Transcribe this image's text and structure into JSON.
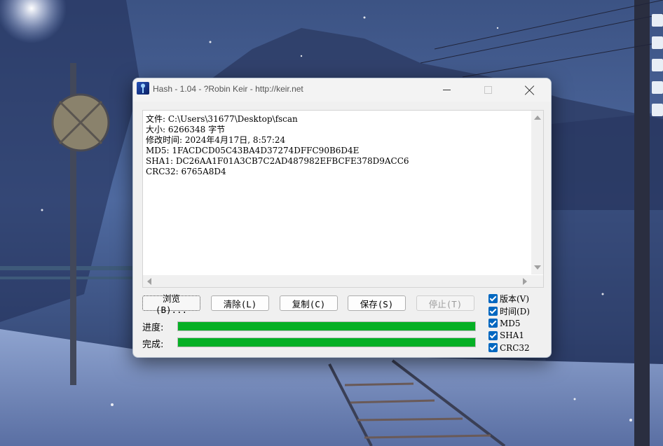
{
  "window": {
    "title": "Hash - 1.04 - ?Robin Keir - http://keir.net"
  },
  "output": {
    "lines": [
      "文件: C:\\Users\\31677\\Desktop\\fscan",
      "大小: 6266348 字节",
      "修改时间: 2024年4月17日, 8:57:24",
      "MD5: 1FACDCD05C43BA4D37274DFFC90B6D4E",
      "SHA1: DC26AA1F01A3CB7C2AD487982EFBCFE378D9ACC6",
      "CRC32: 6765A8D4"
    ]
  },
  "buttons": {
    "browse": "浏览(B)...",
    "clear": "清除(L)",
    "copy": "复制(C)",
    "save": "保存(S)",
    "stop": "停止(T)"
  },
  "progress": {
    "progress_label": "进度:",
    "complete_label": "完成:",
    "progress_value": 1.0,
    "complete_value": 1.0
  },
  "options": [
    {
      "label": "版本(V)",
      "checked": true
    },
    {
      "label": "时间(D)",
      "checked": true
    },
    {
      "label": "MD5",
      "checked": true
    },
    {
      "label": "SHA1",
      "checked": true
    },
    {
      "label": "CRC32",
      "checked": true
    }
  ],
  "colors": {
    "progress_fill": "#06b025",
    "checkbox": "#0067c0"
  },
  "icons": {
    "app": "hash-app-icon",
    "minimize": "minimize-icon",
    "maximize": "maximize-icon",
    "close": "close-icon"
  }
}
